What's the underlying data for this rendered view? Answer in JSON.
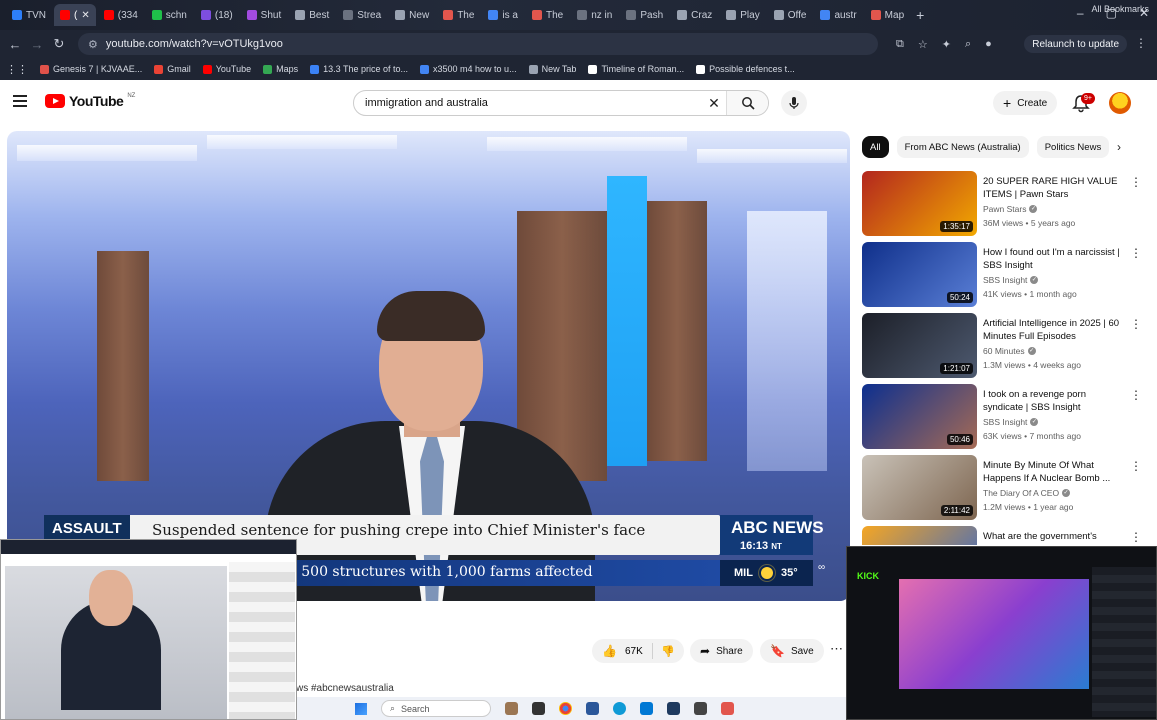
{
  "browser": {
    "tabs": [
      {
        "label": "TVN",
        "color": "#2d7ff9"
      },
      {
        "label": "(",
        "color": "#ff0000",
        "active": true
      },
      {
        "label": "(334",
        "color": "#ff0000"
      },
      {
        "label": "schn",
        "color": "#1fbf4a"
      },
      {
        "label": "(18)",
        "color": "#7d4ee0"
      },
      {
        "label": "Shut",
        "color": "#a24be0"
      },
      {
        "label": "Best",
        "color": "#9aa3b2"
      },
      {
        "label": "Strea",
        "color": "#6b7280"
      },
      {
        "label": "New",
        "color": "#9aa3b2"
      },
      {
        "label": "The",
        "color": "#e2564d"
      },
      {
        "label": "is a",
        "color": "#4285f4"
      },
      {
        "label": "The",
        "color": "#e2564d"
      },
      {
        "label": "nz in",
        "color": "#6b7280"
      },
      {
        "label": "Pash",
        "color": "#6b7280"
      },
      {
        "label": "Craz",
        "color": "#9aa3b2"
      },
      {
        "label": "Play",
        "color": "#9aa3b2"
      },
      {
        "label": "Offe",
        "color": "#9aa3b2"
      },
      {
        "label": "austr",
        "color": "#4285f4"
      },
      {
        "label": "Map",
        "color": "#e2564d"
      }
    ],
    "new_tab": "+",
    "window_controls": [
      "–",
      "▢",
      "✕"
    ],
    "url": "youtube.com/watch?v=vOTUkg1voo",
    "relaunch_label": "Relaunch to update",
    "bookmarks": [
      {
        "label": "Genesis 7 | KJVAAE...",
        "color": "#e0524a"
      },
      {
        "label": "Gmail",
        "color": "#ea4335"
      },
      {
        "label": "YouTube",
        "color": "#ff0000"
      },
      {
        "label": "Maps",
        "color": "#34a853"
      },
      {
        "label": "13.3 The price of to...",
        "color": "#3b82f6"
      },
      {
        "label": "x3500 m4 how to u...",
        "color": "#4285f4"
      },
      {
        "label": "New Tab",
        "color": "#9aa3b2"
      },
      {
        "label": "Timeline of Roman...",
        "color": "#ffffff"
      },
      {
        "label": "Possible defences t...",
        "color": "#ffffff"
      }
    ],
    "all_bookmarks": "All Bookmarks"
  },
  "youtube": {
    "logo_text": "YouTube",
    "country": "NZ",
    "search_query": "immigration and australia",
    "create_label": "Create",
    "notif_badge": "9+"
  },
  "video": {
    "lower_third_tag": "ASSAULT",
    "lower_third_headline": "Suspended sentence for pushing crepe into Chief Minister's face",
    "ticker_text": "st 500 structures with 1,000 farms affected",
    "channel_bug": "ABC NEWS",
    "time": "16:13",
    "timezone": "NT",
    "weather_place": "MIL",
    "weather_temp": "35°",
    "likes": "67K",
    "share_label": "Share",
    "save_label": "Save",
    "hashtags": "ws #abcnewsaustralia"
  },
  "chips": [
    "All",
    "From ABC News (Australia)",
    "Politics News"
  ],
  "recommendations": [
    {
      "title": "20 SUPER RARE HIGH VALUE ITEMS | Pawn Stars",
      "channel": "Pawn Stars",
      "meta": "36M views • 5 years ago",
      "duration": "1:35:17",
      "thumb_colors": [
        "#b3261e",
        "#f2a900"
      ],
      "verified": true
    },
    {
      "title": "How I found out I'm a narcissist | SBS Insight",
      "channel": "SBS Insight",
      "meta": "41K views • 1 month ago",
      "duration": "50:24",
      "thumb_colors": [
        "#0f2f8a",
        "#5a7fd6"
      ],
      "verified": true
    },
    {
      "title": "Artificial Intelligence in 2025 | 60 Minutes Full Episodes",
      "channel": "60 Minutes",
      "meta": "1.3M views • 4 weeks ago",
      "duration": "1:21:07",
      "thumb_colors": [
        "#1c1f28",
        "#4e5a70"
      ],
      "verified": true
    },
    {
      "title": "I took on a revenge porn syndicate | SBS Insight",
      "channel": "SBS Insight",
      "meta": "63K views • 7 months ago",
      "duration": "50:46",
      "thumb_colors": [
        "#0c2f8f",
        "#a66b55"
      ],
      "verified": true
    },
    {
      "title": "Minute By Minute Of What Happens If A Nuclear Bomb ...",
      "channel": "The Diary Of A CEO",
      "meta": "1.2M views • 1 year ago",
      "duration": "2:11:42",
      "thumb_colors": [
        "#c9c2b8",
        "#7e6650"
      ],
      "verified": true
    },
    {
      "title": "What are the government's",
      "channel": "",
      "meta": "",
      "duration": "",
      "thumb_colors": [
        "#f5a623",
        "#3366cc"
      ],
      "verified": false
    }
  ],
  "taskbar": {
    "search_placeholder": "Search"
  },
  "icons": {
    "back": "back-arrow-icon",
    "forward": "forward-arrow-icon",
    "reload": "reload-icon",
    "search": "search-icon",
    "mic": "microphone-icon",
    "bell": "bell-icon",
    "like": "thumbs-up-icon",
    "dislike": "thumbs-down-icon"
  }
}
